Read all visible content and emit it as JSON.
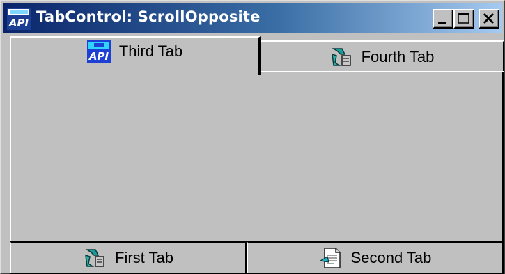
{
  "window": {
    "title": "TabControl: ScrollOpposite",
    "app_icon": "api-icon",
    "controls": [
      "minimize-icon",
      "maximize-icon",
      "close-icon"
    ]
  },
  "tabs_top": [
    {
      "label": "Third Tab",
      "icon": "api-icon",
      "selected": true
    },
    {
      "label": "Fourth Tab",
      "icon": "recycle-icon",
      "selected": false
    }
  ],
  "tabs_bottom": [
    {
      "label": "First Tab",
      "icon": "recycle-icon",
      "selected": false
    },
    {
      "label": "Second Tab",
      "icon": "document-icon",
      "selected": false
    }
  ],
  "colors": {
    "titlebar_start": "#0a246a",
    "titlebar_end": "#a6caf0",
    "face": "#c0c0c0"
  }
}
